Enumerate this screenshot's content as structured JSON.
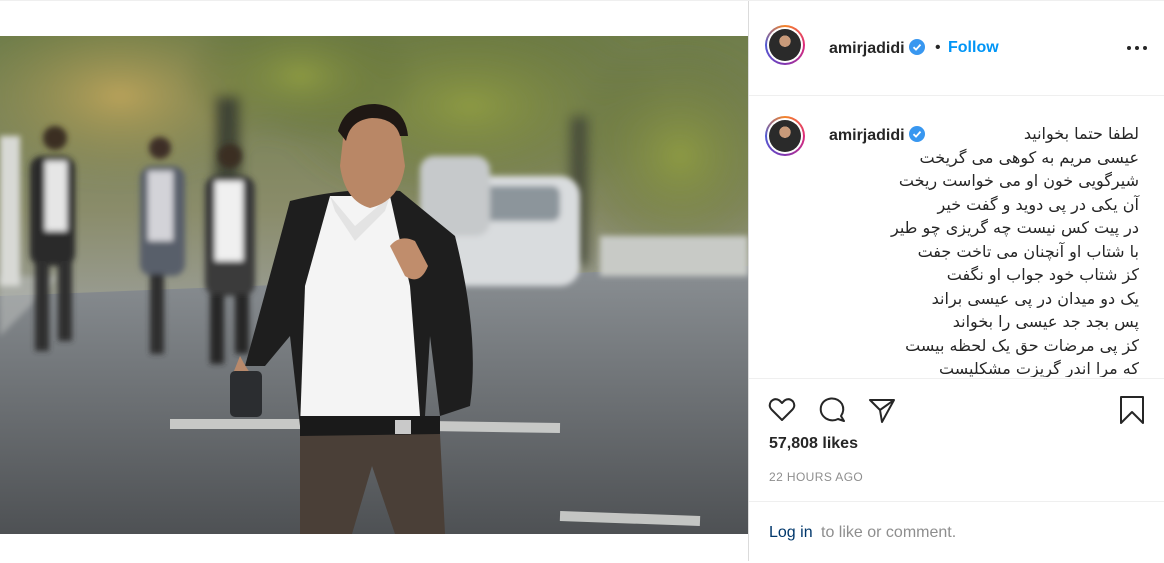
{
  "post": {
    "username": "amirjadidi",
    "follow_label": "Follow",
    "separator": "•",
    "caption_lines": "لطفا حتما بخوانید\nعیسی مریم به کوهی می گریخت\nشیرگویی خون او می خواست ریخت\nآن یکی در پی دوید و گفت خیر\nدر پیت کس نیست چه گریزی چو طیر\nبا شتاب او آنچنان می تاخت جفت\nکز شتاب خود جواب او نگفت\nیک دو میدان در پی عیسی براند\nپس بجد جد عیسی را بخواند\nکز پی مرضات حق یک لحظه بیست\nکه مرا اندر گریزت مشکلیست",
    "likes": "57,808 likes",
    "time": "22 HOURS AGO",
    "login_link": "Log in",
    "login_rest": "to like or comment."
  },
  "colors": {
    "accent": "#0095f6",
    "verified": "#3897f0",
    "muted": "#8e8e8e",
    "text": "#262626"
  },
  "icons": [
    "verified-badge-icon",
    "more-options-icon",
    "heart-icon",
    "comment-icon",
    "share-icon",
    "bookmark-icon"
  ]
}
